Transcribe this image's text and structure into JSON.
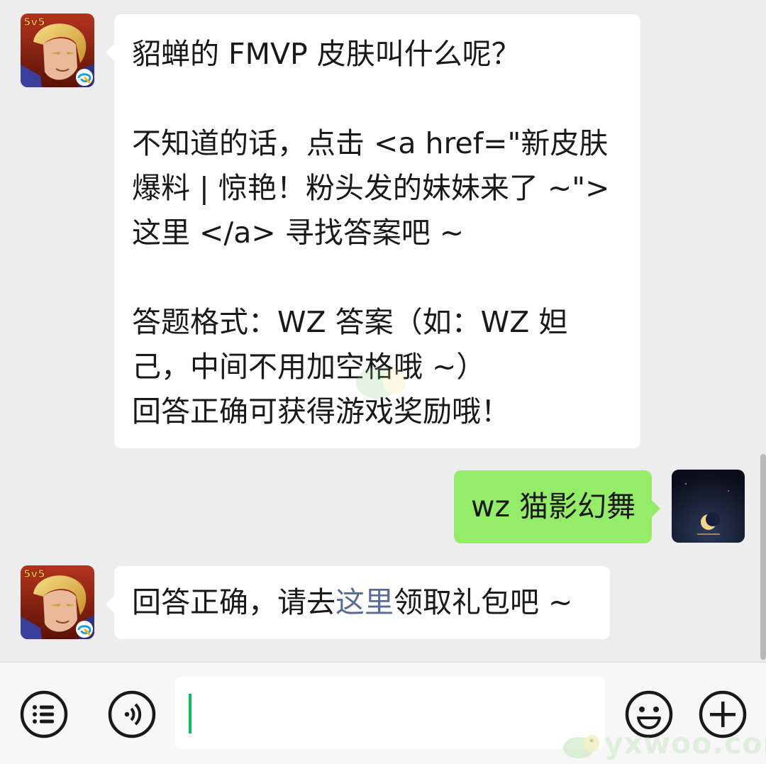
{
  "messages": [
    {
      "from": "other",
      "avatar": "honor-of-kings-avatar",
      "paragraphs": [
        "貂蝉的 FMVP 皮肤叫什么呢？",
        "不知道的话，点击 <a href=\"新皮肤爆料 | 惊艳！粉头发的妹妹来了 ~\"> 这里 </a> 寻找答案吧 ~",
        "答题格式：WZ 答案（如：WZ 妲己，中间不用加空格哦 ~）\n回答正确可获得游戏奖励哦！"
      ]
    },
    {
      "from": "me",
      "avatar": "moon-night-avatar",
      "text": "wz 猫影幻舞"
    },
    {
      "from": "other",
      "avatar": "honor-of-kings-avatar",
      "before_link": "回答正确，请去",
      "link_text": "这里",
      "after_link": "领取礼包吧 ~"
    }
  ],
  "input_bar": {
    "placeholder": "",
    "value": ""
  },
  "icons": {
    "left_1": "menu-list-icon",
    "left_2": "voice-icon",
    "right_1": "emoji-icon",
    "right_2": "plus-icon"
  },
  "watermark": {
    "text": "yxwoo.com"
  },
  "colors": {
    "background": "#ededed",
    "incoming_bubble": "#ffffff",
    "outgoing_bubble": "#95ec69",
    "link": "#576b95",
    "caret": "#07c160"
  }
}
